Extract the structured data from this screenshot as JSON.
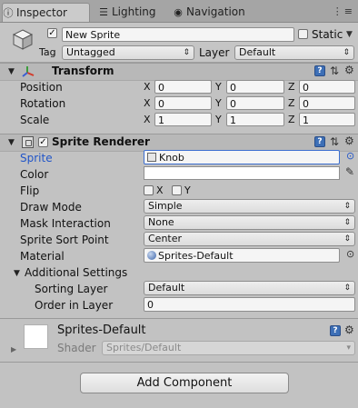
{
  "tabs": [
    {
      "label": "Inspector",
      "icon": "info-icon",
      "active": true
    },
    {
      "label": "Lighting",
      "icon": "lighting-icon",
      "active": false
    },
    {
      "label": "Navigation",
      "icon": "navigation-icon",
      "active": false
    }
  ],
  "object": {
    "name": "New Sprite",
    "active": true,
    "static_label": "Static",
    "tag_label": "Tag",
    "tag_value": "Untagged",
    "layer_label": "Layer",
    "layer_value": "Default"
  },
  "transform": {
    "title": "Transform",
    "rows": [
      {
        "label": "Position",
        "x": "0",
        "y": "0",
        "z": "0"
      },
      {
        "label": "Rotation",
        "x": "0",
        "y": "0",
        "z": "0"
      },
      {
        "label": "Scale",
        "x": "1",
        "y": "1",
        "z": "1"
      }
    ],
    "axis": {
      "x": "X",
      "y": "Y",
      "z": "Z"
    }
  },
  "sprite_renderer": {
    "title": "Sprite Renderer",
    "enabled": true,
    "sprite_label": "Sprite",
    "sprite_value": "Knob",
    "color_label": "Color",
    "color_value": "#ffffff",
    "flip_label": "Flip",
    "flip_x": "X",
    "flip_y": "Y",
    "draw_mode_label": "Draw Mode",
    "draw_mode_value": "Simple",
    "mask_label": "Mask Interaction",
    "mask_value": "None",
    "sort_point_label": "Sprite Sort Point",
    "sort_point_value": "Center",
    "material_label": "Material",
    "material_value": "Sprites-Default",
    "additional_label": "Additional Settings",
    "sorting_layer_label": "Sorting Layer",
    "sorting_layer_value": "Default",
    "order_label": "Order in Layer",
    "order_value": "0"
  },
  "material": {
    "name": "Sprites-Default",
    "shader_label": "Shader",
    "shader_value": "Sprites/Default"
  },
  "add_component_label": "Add Component",
  "colors": {
    "accent": "#3d6fb6",
    "highlight_label": "#2155c8"
  }
}
